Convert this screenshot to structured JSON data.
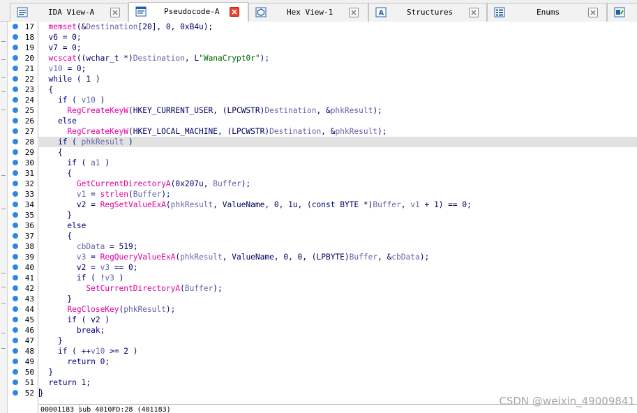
{
  "tabs": [
    {
      "label": "IDA View-A",
      "icon": "listing-icon"
    },
    {
      "label": "Pseudocode-A",
      "icon": "pseudocode-icon",
      "active": true
    },
    {
      "label": "Hex View-1",
      "icon": "hex-icon"
    },
    {
      "label": "Structures",
      "icon": "structures-icon"
    },
    {
      "label": "Enums",
      "icon": "enums-icon"
    }
  ],
  "line_numbers": [
    "17",
    "18",
    "19",
    "20",
    "21",
    "22",
    "23",
    "24",
    "25",
    "26",
    "27",
    "28",
    "29",
    "30",
    "31",
    "32",
    "33",
    "34",
    "35",
    "36",
    "37",
    "38",
    "39",
    "40",
    "41",
    "42",
    "43",
    "44",
    "45",
    "46",
    "47",
    "48",
    "49",
    "50",
    "51",
    "52"
  ],
  "code_lines": [
    "  memset(&Destination[20], 0, 0xB4u);",
    "  v6 = 0;",
    "  v7 = 0;",
    "  wcscat((wchar_t *)Destination, L\"WanaCrypt0r\");",
    "  v10 = 0;",
    "  while ( 1 )",
    "  {",
    "    if ( v10 )",
    "      RegCreateKeyW(HKEY_CURRENT_USER, (LPCWSTR)Destination, &phkResult);",
    "    else",
    "      RegCreateKeyW(HKEY_LOCAL_MACHINE, (LPCWSTR)Destination, &phkResult);",
    "    if ( phkResult )",
    "    {",
    "      if ( a1 )",
    "      {",
    "        GetCurrentDirectoryA(0x207u, Buffer);",
    "        v1 = strlen(Buffer);",
    "        v2 = RegSetValueExA(phkResult, ValueName, 0, 1u, (const BYTE *)Buffer, v1 + 1) == 0;",
    "      }",
    "      else",
    "      {",
    "        cbData = 519;",
    "        v3 = RegQueryValueExA(phkResult, ValueName, 0, 0, (LPBYTE)Buffer, &cbData);",
    "        v2 = v3 == 0;",
    "        if ( !v3 )",
    "          SetCurrentDirectoryA(Buffer);",
    "      }",
    "      RegCloseKey(phkResult);",
    "      if ( v2 )",
    "        break;",
    "    }",
    "    if ( ++v10 >= 2 )",
    "      return 0;",
    "  }",
    "  return 1;",
    "}"
  ],
  "highlighted_line": "28",
  "status_bar": "00001183 sub_4010FD:28 (401183)",
  "watermark": "CSDN @weixin_49009841",
  "colors": {
    "keyword": "#000080",
    "function": "#e000a0",
    "variable": "#6464aa",
    "string": "#006400",
    "dot": "#2f86e8",
    "highlight": "#e2e2e2"
  }
}
